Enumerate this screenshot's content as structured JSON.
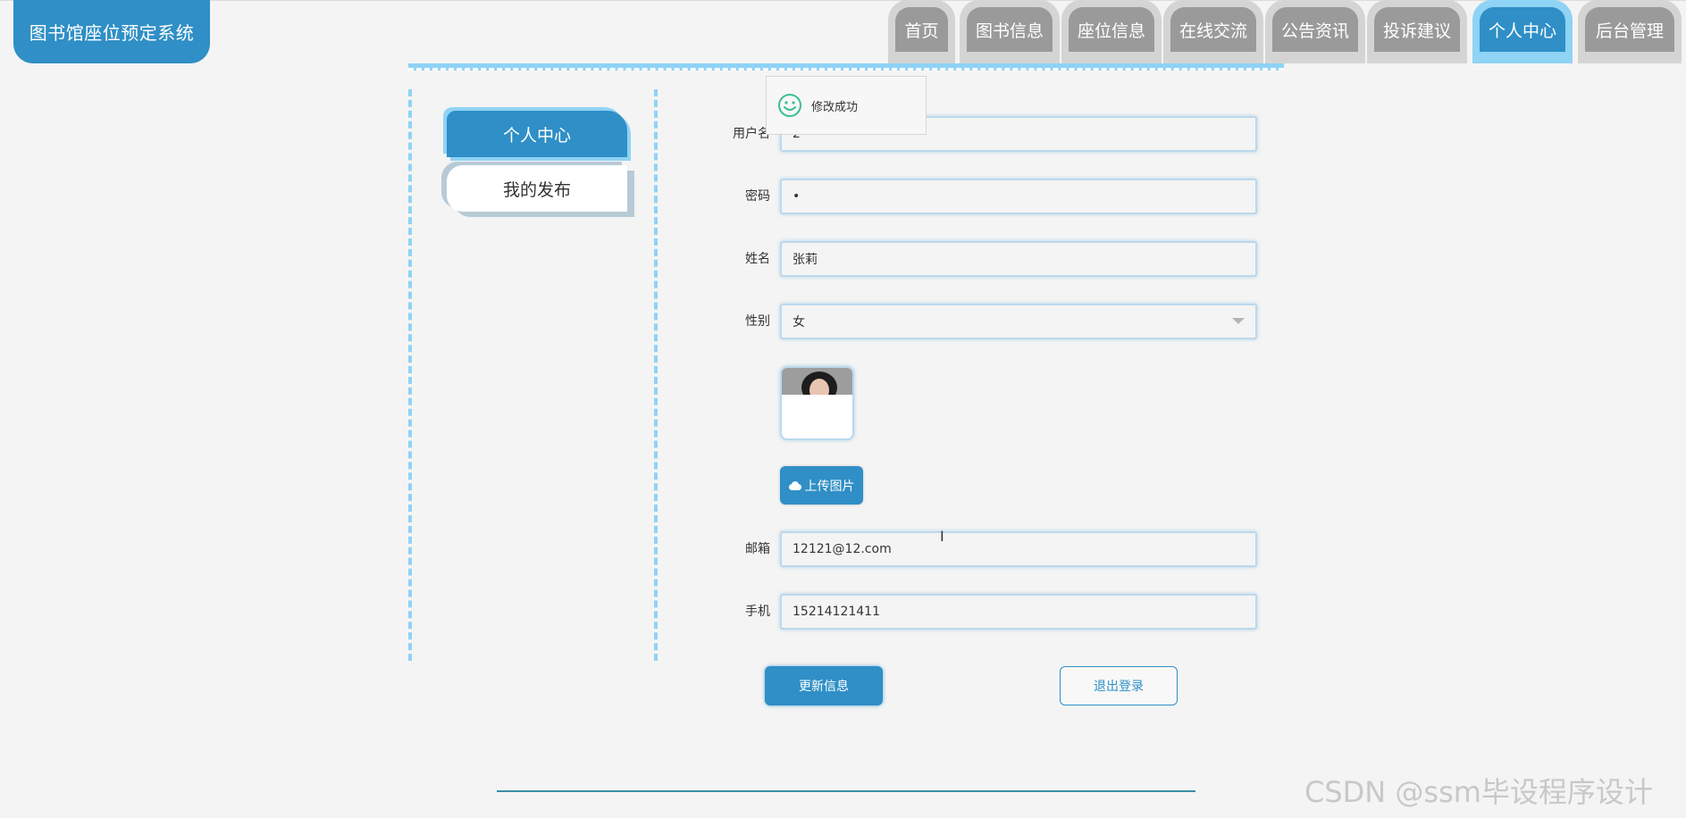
{
  "app": {
    "title": "图书馆座位预定系统"
  },
  "nav": {
    "items": [
      {
        "label": "首页",
        "active": false
      },
      {
        "label": "图书信息",
        "active": false
      },
      {
        "label": "座位信息",
        "active": false
      },
      {
        "label": "在线交流",
        "active": false
      },
      {
        "label": "公告资讯",
        "active": false
      },
      {
        "label": "投诉建议",
        "active": false
      },
      {
        "label": "个人中心",
        "active": true
      },
      {
        "label": "后台管理",
        "active": false
      }
    ]
  },
  "side_menu": {
    "items": [
      {
        "label": "个人中心",
        "active": true
      },
      {
        "label": "我的发布",
        "active": false
      }
    ]
  },
  "form": {
    "username": {
      "label": "用户名",
      "value": "2"
    },
    "password": {
      "label": "密码",
      "value": "•"
    },
    "name": {
      "label": "姓名",
      "value": "张莉"
    },
    "gender": {
      "label": "性别",
      "value": "女"
    },
    "upload_label": "上传图片",
    "email": {
      "label": "邮箱",
      "value": "12121@12.com"
    },
    "phone": {
      "label": "手机",
      "value": "15214121411"
    },
    "update_label": "更新信息",
    "logout_label": "退出登录"
  },
  "toast": {
    "message": "修改成功",
    "icon": "smile-icon"
  },
  "watermark": "CSDN @ssm毕设程序设计",
  "colors": {
    "primary": "#2f8fc6",
    "accent_light": "#8fd3f5",
    "nav_inactive": "#9a9a9a",
    "background": "#f4f4f4",
    "success": "#3bbf8e"
  }
}
